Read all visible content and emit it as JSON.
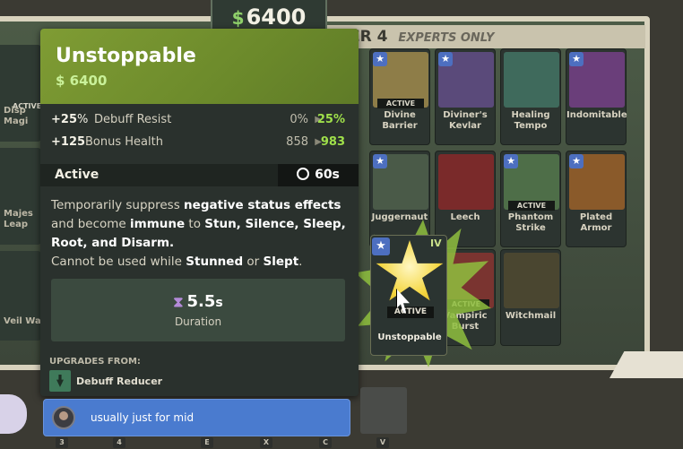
{
  "money_banner": {
    "currency_symbol": "$",
    "amount": "6400"
  },
  "tier_header": {
    "title": "ER 4",
    "subtitle": "EXPERTS ONLY"
  },
  "side_cards": [
    {
      "label": "Disp\nMagi",
      "badge": "ACTIVE"
    },
    {
      "label": "Majes\nLeap",
      "badge": ""
    },
    {
      "label": "Veil Wa",
      "badge": ""
    }
  ],
  "cards": [
    {
      "name": "Divine Barrier",
      "badge": "ACTIVE",
      "starred": true,
      "color": "#8e7d48"
    },
    {
      "name": "Diviner's Kevlar",
      "badge": "",
      "starred": true,
      "color": "#5a4a7a"
    },
    {
      "name": "Healing Tempo",
      "badge": "",
      "starred": false,
      "color": "#3f6a5c"
    },
    {
      "name": "Indomitable",
      "badge": "",
      "starred": true,
      "color": "#6a3e7a"
    },
    {
      "name": "Juggernaut",
      "badge": "",
      "starred": true,
      "color": "#4a5a48"
    },
    {
      "name": "Leech",
      "badge": "",
      "starred": false,
      "color": "#7a2a2a"
    },
    {
      "name": "Phantom Strike",
      "badge": "ACTIVE",
      "starred": true,
      "color": "#4e6e48"
    },
    {
      "name": "Plated Armor",
      "badge": "",
      "starred": true,
      "color": "#8a5a2a"
    },
    {
      "name": "Vampiric Burst",
      "badge": "ACTIVE",
      "starred": false,
      "color": "#7a3430"
    },
    {
      "name": "Witchmail",
      "badge": "",
      "starred": false,
      "color": "#4a4630"
    }
  ],
  "hovered_card": {
    "name": "Unstoppable",
    "badge": "ACTIVE",
    "tier": "IV"
  },
  "tooltip": {
    "title": "Unstoppable",
    "price_symbol": "$",
    "price": "6400",
    "stats": [
      {
        "amount": "+25",
        "amount_suffix": "%",
        "label": "Debuff Resist",
        "from": "0%",
        "to": "25%"
      },
      {
        "amount": "+125",
        "amount_suffix": "",
        "label": "Bonus Health",
        "from": "858",
        "to": "983"
      }
    ],
    "active_label": "Active",
    "cooldown": "60s",
    "description": {
      "p1": "Temporarily suppress ",
      "b1": "negative status effects",
      "p2": " and become ",
      "b2": "immune",
      "p3": " to ",
      "b3": "Stun, Silence, Sleep, Root, and Disarm.",
      "p4": "Cannot be used while ",
      "b4": "Stunned",
      "p5": " or ",
      "b5": "Slept",
      "p6": "."
    },
    "duration_value": "5.5",
    "duration_unit": "s",
    "duration_label": "Duration",
    "upgrades_heading": "UPGRADES FROM:",
    "upgrade_item": "Debuff Reducer"
  },
  "chat": {
    "message": "usually just for mid"
  },
  "hotbar_keys": [
    "3",
    "4",
    "E",
    "X",
    "C",
    "V"
  ],
  "colors": {
    "accent_green": "#9fe04a",
    "tooltip_header": "#7f9c34",
    "chat_blue": "#4a7bcf"
  }
}
